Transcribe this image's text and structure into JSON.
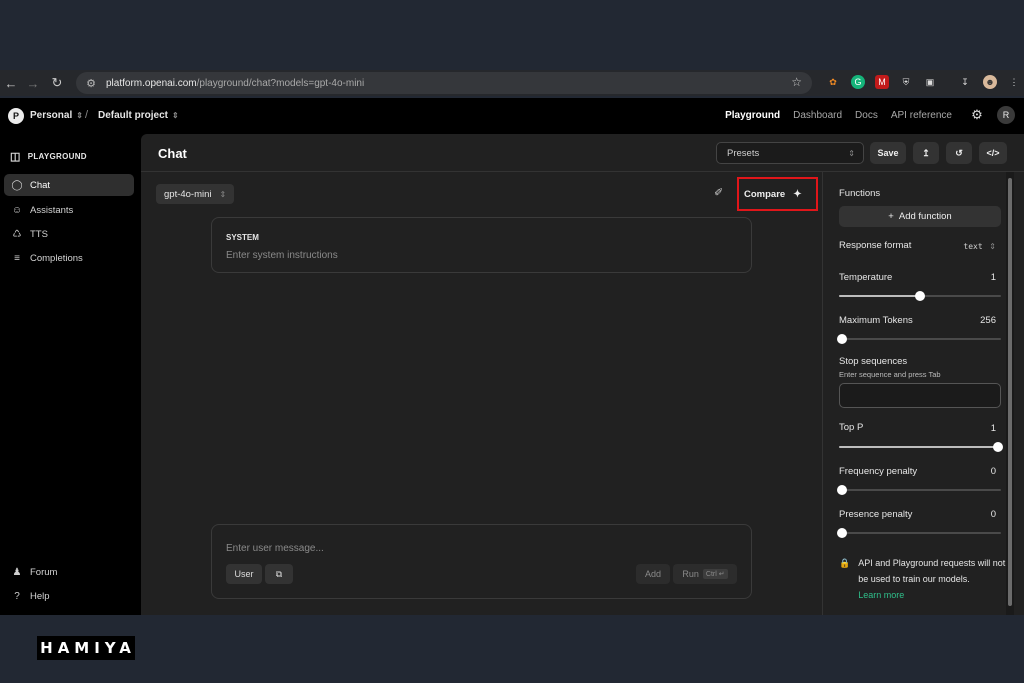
{
  "browser": {
    "url_host": "platform.openai.com",
    "url_path": "/playground/chat?models=gpt-4o-mini"
  },
  "topbar": {
    "org_avatar": "P",
    "org": "Personal",
    "project": "Default project",
    "links": [
      "Playground",
      "Dashboard",
      "Docs",
      "API reference"
    ],
    "user_avatar": "R"
  },
  "sidebar": {
    "title": "PLAYGROUND",
    "items": [
      {
        "label": "Chat",
        "icon": "chat-bubble-icon"
      },
      {
        "label": "Assistants",
        "icon": "assistant-icon"
      },
      {
        "label": "TTS",
        "icon": "microphone-icon"
      },
      {
        "label": "Completions",
        "icon": "lines-icon"
      }
    ],
    "footer": [
      {
        "label": "Forum",
        "icon": "people-icon"
      },
      {
        "label": "Help",
        "icon": "help-icon"
      }
    ]
  },
  "main": {
    "title": "Chat",
    "presets_label": "Presets",
    "save_label": "Save",
    "model": "gpt-4o-mini",
    "compare_label": "Compare",
    "system_label": "SYSTEM",
    "system_placeholder": "Enter system instructions",
    "user_placeholder": "Enter user message...",
    "role_label": "User",
    "add_label": "Add",
    "run_label": "Run",
    "run_shortcut": "Ctrl ↵"
  },
  "settings": {
    "functions_label": "Functions",
    "add_function_label": "Add function",
    "response_format_label": "Response format",
    "response_format_value": "text",
    "temperature_label": "Temperature",
    "temperature_value": "1",
    "temperature_level": 0.5,
    "max_tokens_label": "Maximum Tokens",
    "max_tokens_value": "256",
    "max_tokens_level": 0.0,
    "stop_label": "Stop sequences",
    "stop_hint": "Enter sequence and press Tab",
    "top_p_label": "Top P",
    "top_p_value": "1",
    "top_p_level": 1.0,
    "freq_label": "Frequency penalty",
    "freq_value": "0",
    "freq_level": 0.0,
    "presence_label": "Presence penalty",
    "presence_value": "0",
    "presence_level": 0.0,
    "notice": "API and Playground requests will not be used to train our models.",
    "learn_more": "Learn more"
  },
  "brand": "HAMIYA",
  "colors": {
    "highlight": "#e0161a",
    "link": "#2fbf8a"
  }
}
